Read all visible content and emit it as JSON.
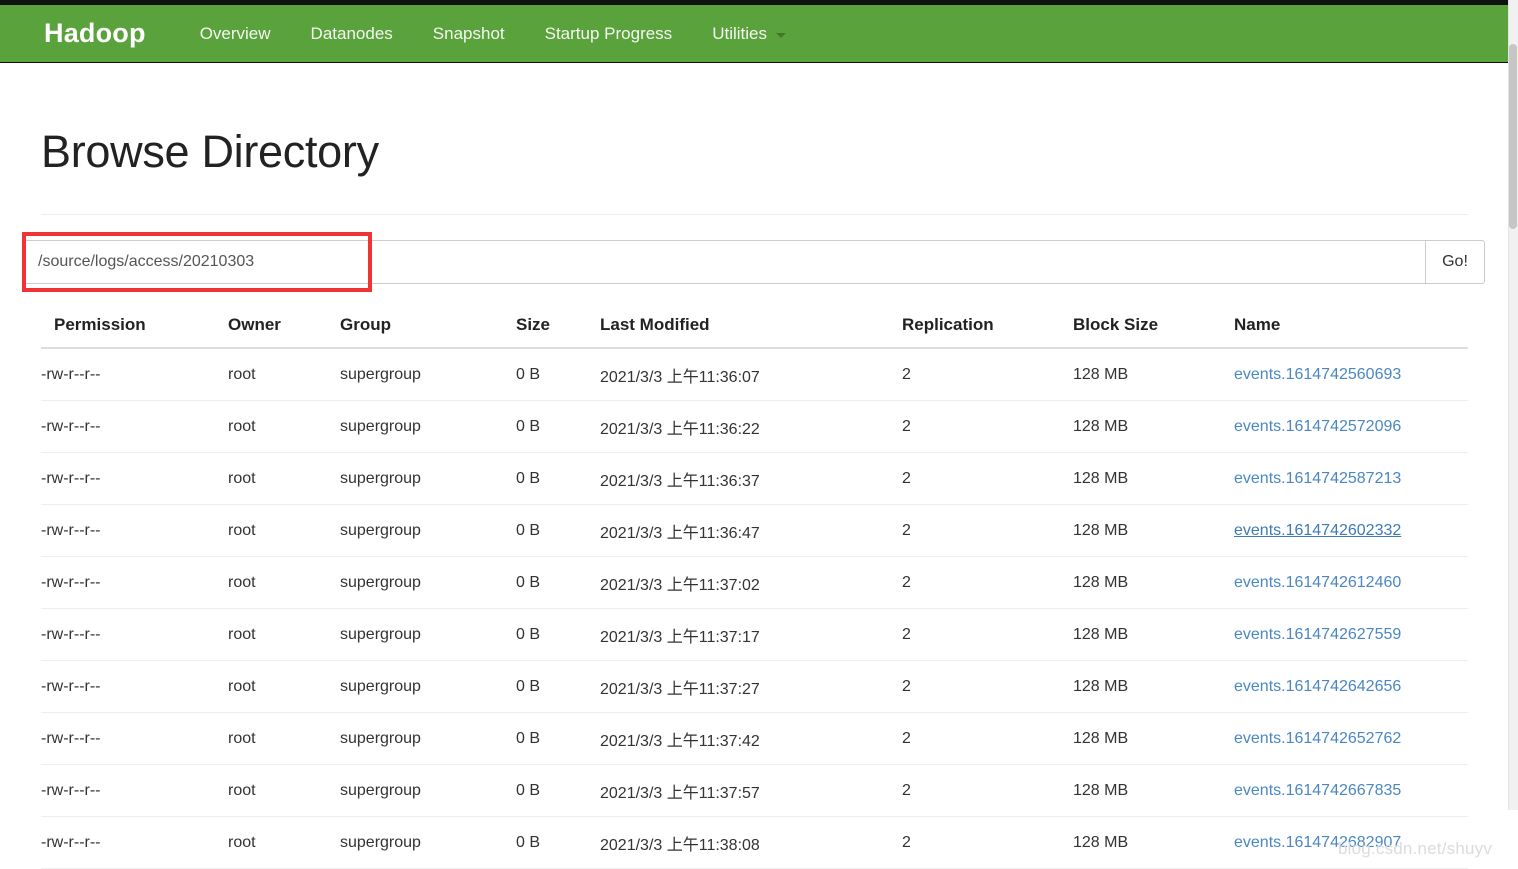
{
  "navbar": {
    "brand": "Hadoop",
    "items": [
      {
        "label": "Overview",
        "icon": ""
      },
      {
        "label": "Datanodes",
        "icon": ""
      },
      {
        "label": "Snapshot",
        "icon": ""
      },
      {
        "label": "Startup Progress",
        "icon": ""
      },
      {
        "label": "Utilities",
        "icon": "chevron-down-icon"
      }
    ],
    "brand_color": "#5aa23c"
  },
  "page": {
    "title": "Browse Directory"
  },
  "path_bar": {
    "value": "/source/logs/access/20210303",
    "placeholder": "",
    "go_label": "Go!"
  },
  "annotation": {
    "color": "#f03434"
  },
  "table": {
    "columns": [
      "Permission",
      "Owner",
      "Group",
      "Size",
      "Last Modified",
      "Replication",
      "Block Size",
      "Name"
    ],
    "rows": [
      {
        "permission": "-rw-r--r--",
        "owner": "root",
        "group": "supergroup",
        "size": "0 B",
        "modified": "2021/3/3 上午11:36:07",
        "replication": "2",
        "block_size": "128 MB",
        "name": "events.1614742560693",
        "hovered": false
      },
      {
        "permission": "-rw-r--r--",
        "owner": "root",
        "group": "supergroup",
        "size": "0 B",
        "modified": "2021/3/3 上午11:36:22",
        "replication": "2",
        "block_size": "128 MB",
        "name": "events.1614742572096",
        "hovered": false
      },
      {
        "permission": "-rw-r--r--",
        "owner": "root",
        "group": "supergroup",
        "size": "0 B",
        "modified": "2021/3/3 上午11:36:37",
        "replication": "2",
        "block_size": "128 MB",
        "name": "events.1614742587213",
        "hovered": false
      },
      {
        "permission": "-rw-r--r--",
        "owner": "root",
        "group": "supergroup",
        "size": "0 B",
        "modified": "2021/3/3 上午11:36:47",
        "replication": "2",
        "block_size": "128 MB",
        "name": "events.1614742602332",
        "hovered": true
      },
      {
        "permission": "-rw-r--r--",
        "owner": "root",
        "group": "supergroup",
        "size": "0 B",
        "modified": "2021/3/3 上午11:37:02",
        "replication": "2",
        "block_size": "128 MB",
        "name": "events.1614742612460",
        "hovered": false
      },
      {
        "permission": "-rw-r--r--",
        "owner": "root",
        "group": "supergroup",
        "size": "0 B",
        "modified": "2021/3/3 上午11:37:17",
        "replication": "2",
        "block_size": "128 MB",
        "name": "events.1614742627559",
        "hovered": false
      },
      {
        "permission": "-rw-r--r--",
        "owner": "root",
        "group": "supergroup",
        "size": "0 B",
        "modified": "2021/3/3 上午11:37:27",
        "replication": "2",
        "block_size": "128 MB",
        "name": "events.1614742642656",
        "hovered": false
      },
      {
        "permission": "-rw-r--r--",
        "owner": "root",
        "group": "supergroup",
        "size": "0 B",
        "modified": "2021/3/3 上午11:37:42",
        "replication": "2",
        "block_size": "128 MB",
        "name": "events.1614742652762",
        "hovered": false
      },
      {
        "permission": "-rw-r--r--",
        "owner": "root",
        "group": "supergroup",
        "size": "0 B",
        "modified": "2021/3/3 上午11:37:57",
        "replication": "2",
        "block_size": "128 MB",
        "name": "events.1614742667835",
        "hovered": false
      },
      {
        "permission": "-rw-r--r--",
        "owner": "root",
        "group": "supergroup",
        "size": "0 B",
        "modified": "2021/3/3 上午11:38:08",
        "replication": "2",
        "block_size": "128 MB",
        "name": "events.1614742682907",
        "hovered": false
      }
    ]
  },
  "watermark": {
    "text": "blog.csdn.net/shuyv"
  }
}
